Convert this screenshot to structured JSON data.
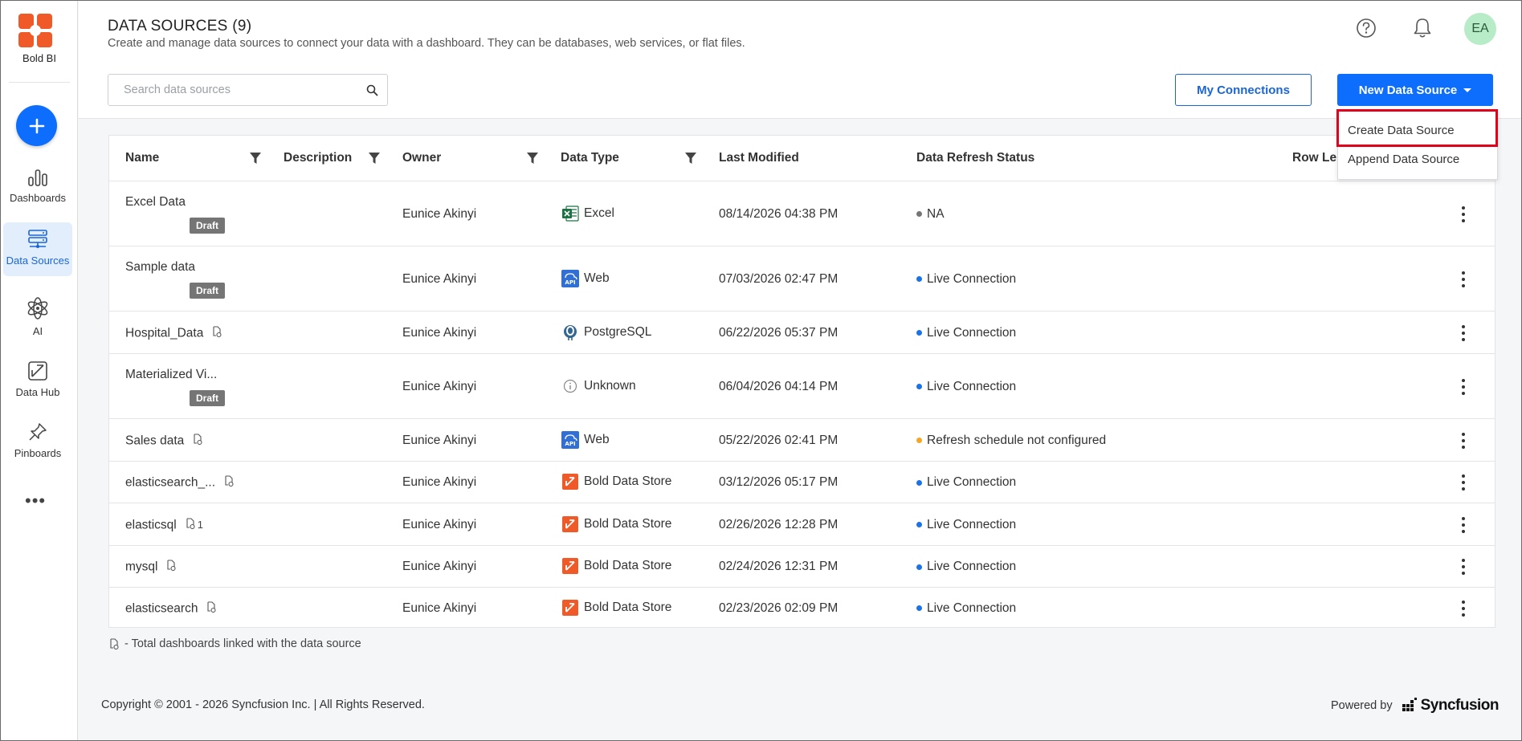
{
  "sidebar": {
    "app_name": "Bold BI",
    "items": [
      {
        "label": "Dashboards"
      },
      {
        "label": "Data Sources"
      },
      {
        "label": "AI"
      },
      {
        "label": "Data Hub"
      },
      {
        "label": "Pinboards"
      }
    ],
    "more": "•••"
  },
  "header": {
    "title": "DATA SOURCES (9)",
    "subtitle": "Create and manage data sources to connect your data with a dashboard. They can be databases, web services, or flat files.",
    "avatar_initials": "EA",
    "search_placeholder": "Search data sources",
    "my_connections": "My Connections",
    "new_data_source": "New Data Source"
  },
  "dropdown": {
    "items": [
      "Create Data Source",
      "Append Data Source"
    ],
    "highlight_color": "#e3001b"
  },
  "table": {
    "columns": [
      "Name",
      "Description",
      "Owner",
      "Data Type",
      "Last Modified",
      "Data Refresh Status",
      "Row Le"
    ],
    "rows": [
      {
        "name": "Excel Data",
        "draft": "Draft",
        "owner": "Eunice Akinyi",
        "type": "Excel",
        "type_icon": "excel-icon",
        "modified": "08/14/2026 04:38 PM",
        "status": "NA",
        "status_color": "#757575"
      },
      {
        "name": "Sample data",
        "draft": "Draft",
        "owner": "Eunice Akinyi",
        "type": "Web",
        "type_icon": "web-api-icon",
        "modified": "07/03/2026 02:47 PM",
        "status": "Live Connection",
        "status_color": "#1a73e8"
      },
      {
        "name": "Hospital_Data",
        "linked": true,
        "owner": "Eunice Akinyi",
        "type": "PostgreSQL",
        "type_icon": "postgresql-icon",
        "modified": "06/22/2026 05:37 PM",
        "status": "Live Connection",
        "status_color": "#1a73e8"
      },
      {
        "name": "Materialized Vi...",
        "draft": "Draft",
        "owner": "Eunice Akinyi",
        "type": "Unknown",
        "type_icon": "info-icon",
        "modified": "06/04/2026 04:14 PM",
        "status": "Live Connection",
        "status_color": "#1a73e8"
      },
      {
        "name": "Sales data",
        "linked": true,
        "owner": "Eunice Akinyi",
        "type": "Web",
        "type_icon": "web-api-icon",
        "modified": "05/22/2026 02:41 PM",
        "status": "Refresh schedule not configured",
        "status_color": "#f5a623"
      },
      {
        "name": "elasticsearch_...",
        "linked": true,
        "owner": "Eunice Akinyi",
        "type": "Bold Data Store",
        "type_icon": "bold-data-store-icon",
        "modified": "03/12/2026 05:17 PM",
        "status": "Live Connection",
        "status_color": "#1a73e8"
      },
      {
        "name": "elasticsql",
        "linked": true,
        "link_count": "1",
        "owner": "Eunice Akinyi",
        "type": "Bold Data Store",
        "type_icon": "bold-data-store-icon",
        "modified": "02/26/2026 12:28 PM",
        "status": "Live Connection",
        "status_color": "#1a73e8"
      },
      {
        "name": "mysql",
        "linked": true,
        "owner": "Eunice Akinyi",
        "type": "Bold Data Store",
        "type_icon": "bold-data-store-icon",
        "modified": "02/24/2026 12:31 PM",
        "status": "Live Connection",
        "status_color": "#1a73e8"
      },
      {
        "name": "elasticsearch",
        "linked": true,
        "owner": "Eunice Akinyi",
        "type": "Bold Data Store",
        "type_icon": "bold-data-store-icon",
        "modified": "02/23/2026 02:09 PM",
        "status": "Live Connection",
        "status_color": "#1a73e8"
      }
    ]
  },
  "footnote": "- Total dashboards linked with the data source",
  "footer": {
    "copyright": "Copyright © 2001 - 2026 Syncfusion Inc. | All Rights Reserved.",
    "powered_by": "Powered by",
    "brand": "Syncfusion"
  },
  "colors": {
    "accent": "#0d6efd",
    "brand": "#f05a28"
  }
}
